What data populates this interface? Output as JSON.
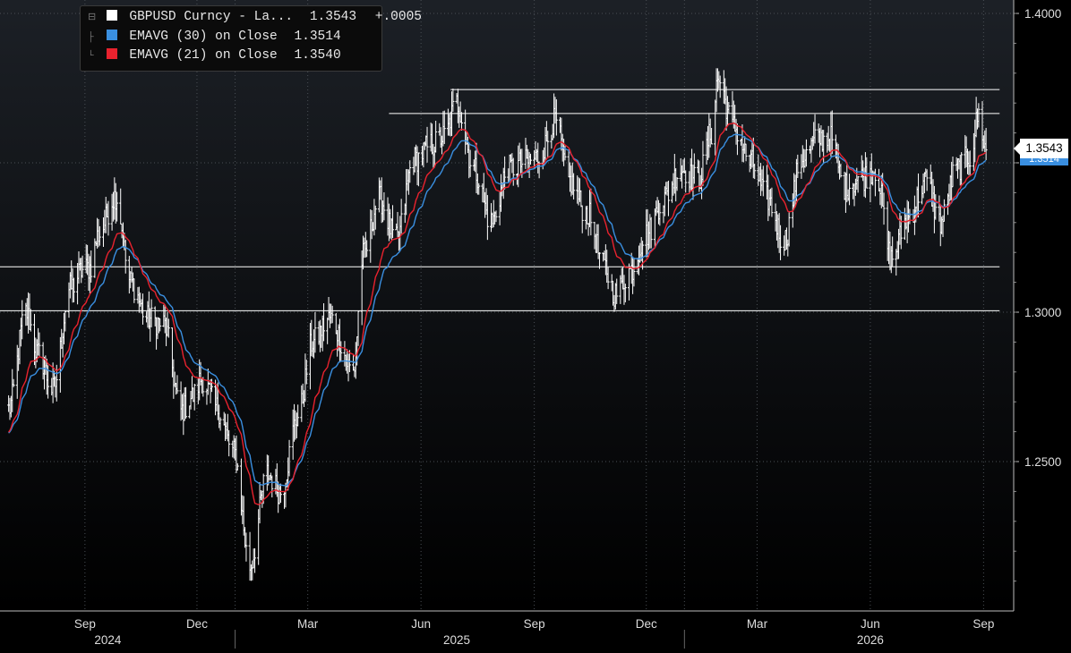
{
  "legend": {
    "main": {
      "label": "GBPUSD Curncy - La...",
      "value": "1.3543",
      "change": "+.0005",
      "color": "#ffffff"
    },
    "ema30": {
      "label": "EMAVG (30)  on Close",
      "value": "1.3514",
      "color": "#3a8fe0"
    },
    "ema21": {
      "label": "EMAVG (21)  on Close",
      "value": "1.3540",
      "color": "#e8222e"
    }
  },
  "last_price_tag": "1.3543",
  "ema_tag": "1.3514",
  "chart_data": {
    "type": "line",
    "title": "",
    "xlabel": "",
    "ylabel": "",
    "ylim": [
      1.2,
      1.41
    ],
    "yticks": [
      1.25,
      1.3,
      1.35,
      1.4
    ],
    "ytick_labels": [
      "1.2500",
      "1.3000",
      "",
      "1.4000"
    ],
    "x_month_labels": [
      "Sep",
      "Dec",
      "Mar",
      "Jun",
      "Sep",
      "Dec",
      "Mar",
      "Jun",
      "Sep"
    ],
    "x_year_labels": [
      "2024",
      "2025",
      "2026"
    ],
    "grid": true,
    "background": "#000000",
    "colors": {
      "price": "#ffffff",
      "ema30": "#3a8fe0",
      "ema21": "#e8222e",
      "grid": "#555555",
      "hline": "#ffffff"
    },
    "series": [
      {
        "name": "GBPUSD Curncy",
        "type": "bars",
        "anchors": [
          [
            "2024-07-01",
            1.2675
          ],
          [
            "2024-07-15",
            1.3
          ],
          [
            "2024-07-25",
            1.286
          ],
          [
            "2024-08-06",
            1.274
          ],
          [
            "2024-08-20",
            1.308
          ],
          [
            "2024-08-30",
            1.314
          ],
          [
            "2024-09-05",
            1.315
          ],
          [
            "2024-09-12",
            1.326
          ],
          [
            "2024-09-26",
            1.339
          ],
          [
            "2024-10-08",
            1.31
          ],
          [
            "2024-10-22",
            1.298
          ],
          [
            "2024-11-04",
            1.296
          ],
          [
            "2024-11-18",
            1.267
          ],
          [
            "2024-11-28",
            1.272
          ],
          [
            "2024-12-05",
            1.278
          ],
          [
            "2024-12-17",
            1.268
          ],
          [
            "2024-12-31",
            1.253
          ],
          [
            "2025-01-13",
            1.215
          ],
          [
            "2025-01-27",
            1.246
          ],
          [
            "2025-02-07",
            1.24
          ],
          [
            "2025-02-21",
            1.265
          ],
          [
            "2025-03-05",
            1.29
          ],
          [
            "2025-03-19",
            1.298
          ],
          [
            "2025-04-07",
            1.28
          ],
          [
            "2025-04-15",
            1.319
          ],
          [
            "2025-04-28",
            1.338
          ],
          [
            "2025-05-12",
            1.324
          ],
          [
            "2025-05-26",
            1.351
          ],
          [
            "2025-06-10",
            1.356
          ],
          [
            "2025-06-20",
            1.359
          ],
          [
            "2025-06-30",
            1.37
          ],
          [
            "2025-07-14",
            1.348
          ],
          [
            "2025-07-28",
            1.33
          ],
          [
            "2025-08-11",
            1.348
          ],
          [
            "2025-08-25",
            1.35
          ],
          [
            "2025-09-05",
            1.352
          ],
          [
            "2025-09-18",
            1.364
          ],
          [
            "2025-09-29",
            1.344
          ],
          [
            "2025-10-14",
            1.333
          ],
          [
            "2025-10-28",
            1.315
          ],
          [
            "2025-11-06",
            1.306
          ],
          [
            "2025-11-18",
            1.314
          ],
          [
            "2025-12-01",
            1.326
          ],
          [
            "2025-12-15",
            1.338
          ],
          [
            "2025-12-29",
            1.348
          ],
          [
            "2026-01-12",
            1.344
          ],
          [
            "2026-01-23",
            1.36
          ],
          [
            "2026-01-28",
            1.378
          ],
          [
            "2026-02-10",
            1.362
          ],
          [
            "2026-02-24",
            1.35
          ],
          [
            "2026-03-09",
            1.338
          ],
          [
            "2026-03-23",
            1.324
          ],
          [
            "2026-04-06",
            1.351
          ],
          [
            "2026-04-20",
            1.358
          ],
          [
            "2026-04-30",
            1.358
          ],
          [
            "2026-05-11",
            1.342
          ],
          [
            "2026-05-25",
            1.345
          ],
          [
            "2026-06-05",
            1.348
          ],
          [
            "2026-06-18",
            1.318
          ],
          [
            "2026-07-02",
            1.332
          ],
          [
            "2026-07-16",
            1.344
          ],
          [
            "2026-07-28",
            1.33
          ],
          [
            "2026-08-10",
            1.348
          ],
          [
            "2026-08-21",
            1.352
          ],
          [
            "2026-08-28",
            1.366
          ],
          [
            "2026-09-03",
            1.3543
          ]
        ],
        "last": 1.3543,
        "change": 0.0005
      },
      {
        "name": "EMAVG (30) on Close",
        "type": "line",
        "period": 30,
        "last": 1.3514
      },
      {
        "name": "EMAVG (21) on Close",
        "type": "line",
        "period": 21,
        "last": 1.354
      }
    ],
    "horizontal_lines": [
      {
        "y": 1.3745,
        "from": "2025-06-25",
        "to": "2026-09-14"
      },
      {
        "y": 1.3665,
        "from": "2025-05-06",
        "to": "2026-09-14"
      },
      {
        "y": 1.3152,
        "from": "2024-06-19",
        "to": "2026-09-14"
      },
      {
        "y": 1.3005,
        "from": "2024-06-10",
        "to": "2026-09-14"
      }
    ]
  }
}
